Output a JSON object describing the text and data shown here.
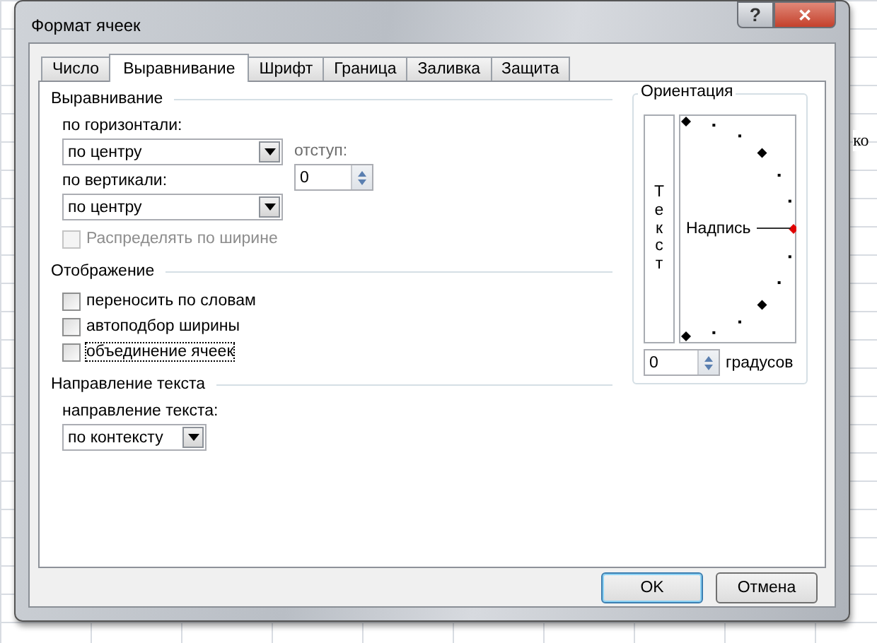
{
  "background_cell": "ко",
  "window": {
    "title": "Формат ячеек",
    "help_button": "?",
    "close_button": "✕"
  },
  "tabs": [
    {
      "label": "Число",
      "selected": false
    },
    {
      "label": "Выравнивание",
      "selected": true
    },
    {
      "label": "Шрифт",
      "selected": false
    },
    {
      "label": "Граница",
      "selected": false
    },
    {
      "label": "Заливка",
      "selected": false
    },
    {
      "label": "Защита",
      "selected": false
    }
  ],
  "alignment": {
    "title": "Выравнивание",
    "horizontal": {
      "label": "по горизонтали:",
      "value": "по центру"
    },
    "indent": {
      "label": "отступ:",
      "value": "0"
    },
    "vertical": {
      "label": "по вертикали:",
      "value": "по центру"
    },
    "distribute": {
      "label": "Распределять по ширине",
      "checked": false,
      "disabled": true
    }
  },
  "display": {
    "title": "Отображение",
    "options": [
      {
        "label": "переносить по словам",
        "checked": false,
        "focused": false
      },
      {
        "label": "автоподбор ширины",
        "checked": false,
        "focused": false
      },
      {
        "label": "объединение ячеек",
        "checked": false,
        "focused": true
      }
    ]
  },
  "direction": {
    "title": "Направление текста",
    "label": "направление текста:",
    "value": "по контексту"
  },
  "orientation": {
    "title": "Ориентация",
    "vertical_text": "Текст",
    "dial_label": "Надпись",
    "degrees_value": "0",
    "degrees_label": "градусов"
  },
  "buttons": [
    {
      "label": "OK",
      "default": true
    },
    {
      "label": "Отмена",
      "default": false
    }
  ]
}
